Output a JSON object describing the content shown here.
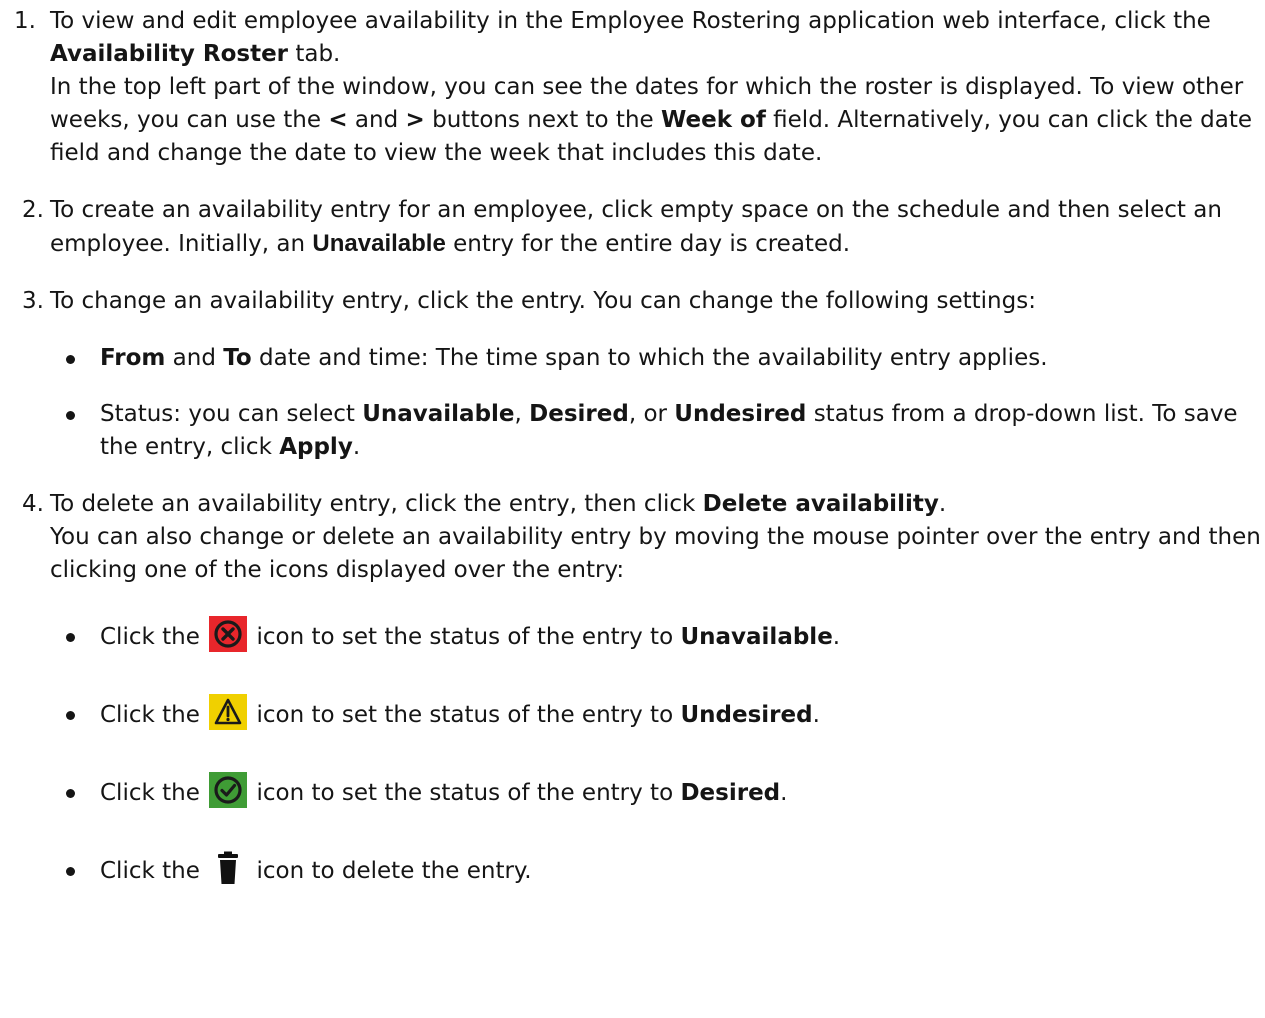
{
  "steps": [
    {
      "number": "1.",
      "p1_a": "To view and edit employee availability in the Employee Rostering application web interface, click the ",
      "p1_b": "Availability Roster",
      "p1_c": " tab.",
      "p2_a": "In the top left part of the window, you can see the dates for which the roster is displayed. To view other weeks, you can use the ",
      "p2_prev": "<",
      "p2_and": " and ",
      "p2_next": ">",
      "p2_b": " buttons next to the  ",
      "p2_week": "Week of",
      "p2_c": " field. Alternatively, you can click the date field and change the date to view the week that includes this date."
    },
    {
      "number": "2.",
      "a": "To create an availability entry for an employee, click empty space on the schedule and then select an employee. Initially, an ",
      "b": "Unavailable",
      "c": " entry for the entire day is created."
    },
    {
      "number": "3.",
      "intro": "To change an availability entry, click the entry. You can change the following settings:",
      "bullets": [
        {
          "from": "From",
          "and": " and ",
          "to": "To",
          "rest": " date and time: The time span to which the availability entry applies."
        },
        {
          "a": "Status: you can select ",
          "unavailable": "Unavailable",
          "comma1": ", ",
          "desired": "Desired",
          "or": ", or ",
          "undesired": "Undesired",
          "b": " status from a drop-down list. To save the entry, click ",
          "apply": "Apply",
          "end": "."
        }
      ]
    },
    {
      "number": "4.",
      "a": "To delete an availability entry, click the entry, then click ",
      "b": "Delete availability",
      "c": ".",
      "p2": "You can also change or delete an availability entry by moving the mouse pointer over the entry and then clicking one of the icons displayed over the entry:",
      "icon_items": [
        {
          "pre": "Click the ",
          "icon": "unavailable-icon",
          "post": " icon to set the status of the entry to ",
          "status": "Unavailable",
          "end": "."
        },
        {
          "pre": "Click the ",
          "icon": "undesired-icon",
          "post": " icon to set the status of the entry to ",
          "status": "Undesired",
          "end": "."
        },
        {
          "pre": "Click the ",
          "icon": "desired-icon",
          "post": " icon to set the status of the entry to ",
          "status": "Desired",
          "end": "."
        },
        {
          "pre": "Click the ",
          "icon": "trash-icon",
          "post": " icon to delete the entry.",
          "status": "",
          "end": ""
        }
      ]
    }
  ],
  "colors": {
    "text": "#151515",
    "unavailable": "#e8262b",
    "undesired": "#f0d000",
    "desired": "#3f9c35",
    "trash": "#111111"
  }
}
